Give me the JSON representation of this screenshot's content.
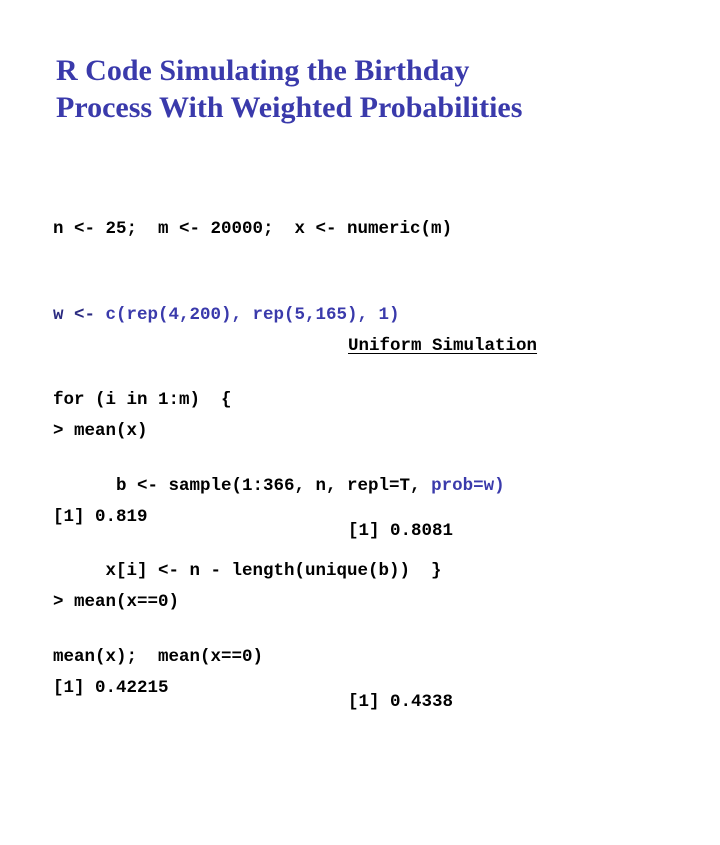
{
  "slide": {
    "background_color": "#ffffff",
    "title_color": "#3a3aab",
    "code_color": "#000000",
    "code_accent_color": "#3a3aab"
  },
  "title": {
    "line1": "R Code Simulating the Birthday",
    "line2": "Process With Weighted Probabilities"
  },
  "code": {
    "line1_a": "n <- 25;  m <- 20000;  x <- numeric(m)",
    "line2_a": "w <- ",
    "line2_b": "c(rep(4,200), rep(5,165), 1)",
    "line3_a": "for (i in 1:m)  {",
    "line4_a": "      b <- sample(1:366, n, repl=T, ",
    "line4_b": "prob=w)",
    "line5_a": "     x[i] <- n - length(unique(b))  }",
    "line6_a": "mean(x);  mean(x==0)"
  },
  "uniform_heading": {
    "label": "Uniform Simulation"
  },
  "output_left": {
    "line1": "> mean(x)",
    "line2": "[1] 0.819",
    "line3": "> mean(x==0)",
    "line4": "[1] 0.42215"
  },
  "output_right": {
    "line1": "[1] 0.8081",
    "line2": "[1] 0.4338"
  }
}
